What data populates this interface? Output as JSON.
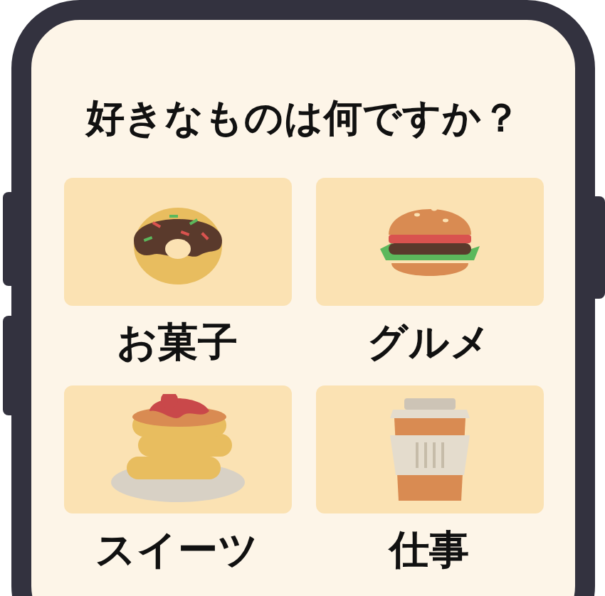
{
  "question": "好きなものは何ですか？",
  "categories": [
    {
      "kind": "donut",
      "label": "お菓子"
    },
    {
      "kind": "burger",
      "label": "グルメ"
    },
    {
      "kind": "pancake",
      "label": "スイーツ"
    },
    {
      "kind": "coffee",
      "label": "仕事"
    }
  ]
}
